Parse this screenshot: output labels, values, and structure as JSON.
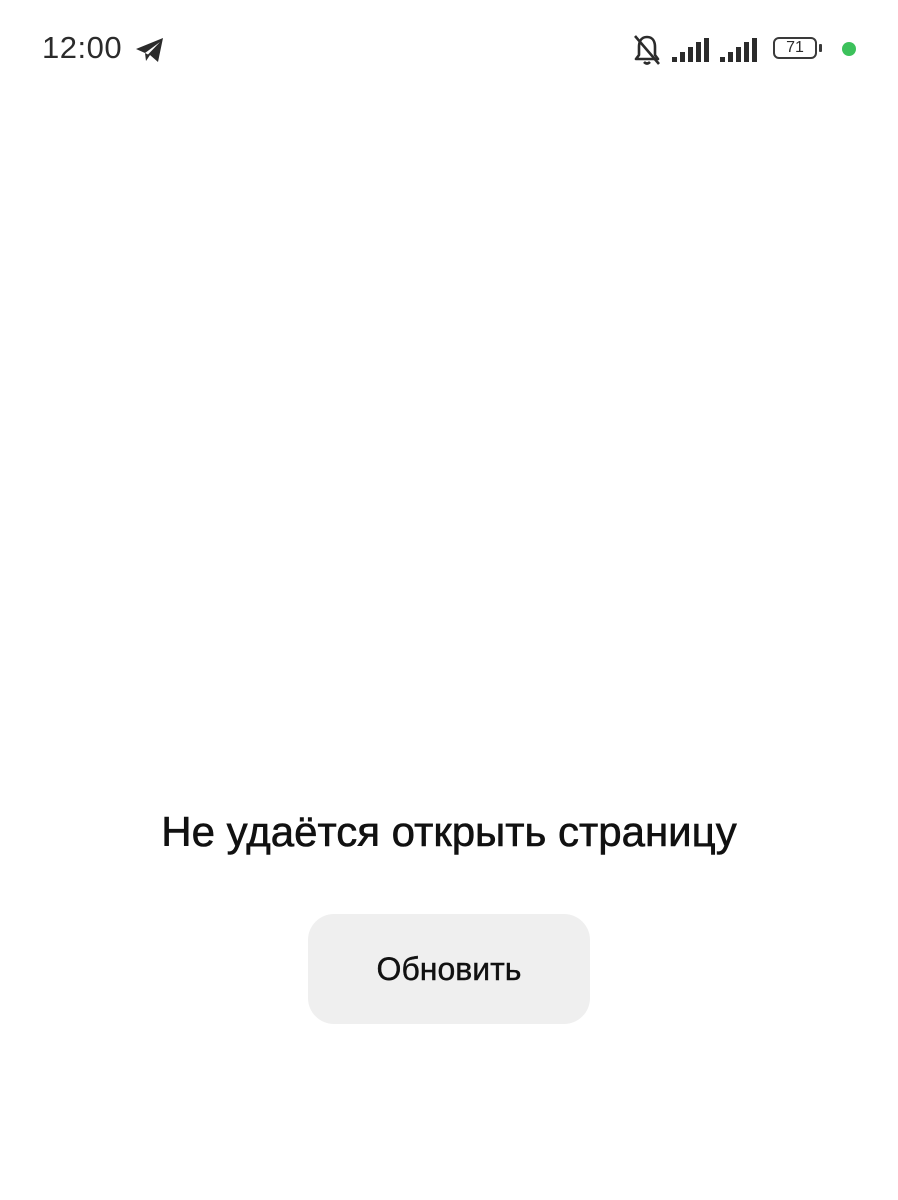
{
  "status_bar": {
    "time": "12:00",
    "battery_level": "71",
    "icons": [
      "telegram-icon",
      "bell-off-icon",
      "signal-icon",
      "signal-icon",
      "battery-icon",
      "green-dot-indicator"
    ],
    "indicator_color": "#3cc15b"
  },
  "main": {
    "error_message": "Не удаётся открыть страницу",
    "refresh_label": "Обновить"
  }
}
